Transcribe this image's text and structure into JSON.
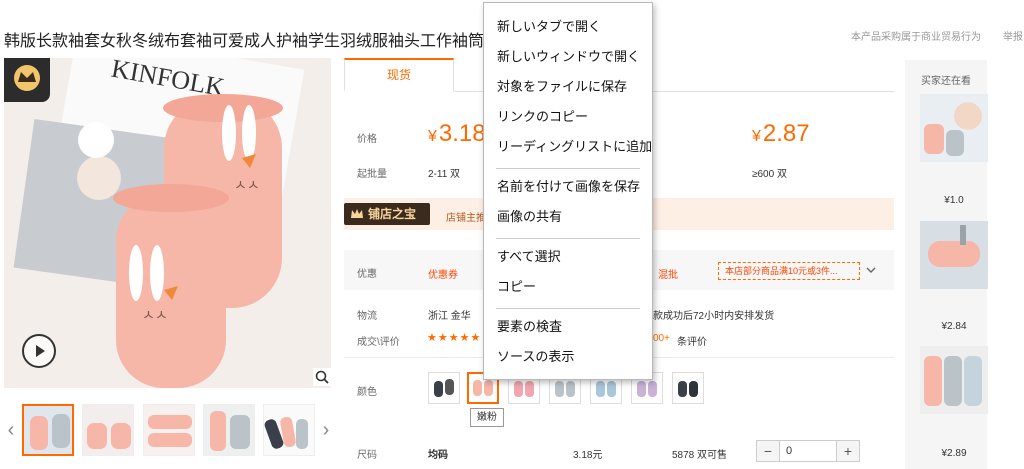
{
  "header": {
    "title": "韩版长款袖套女秋冬绒布套袖可爱成人护袖学生羽绒服袖头工作袖筒",
    "report_note": "本产品采购属于商业贸易行为",
    "report_link": "举报"
  },
  "tabs": {
    "active": "现货"
  },
  "price": {
    "label": "价格",
    "value_1": "3.18",
    "value_2": "2.87",
    "currency_symbol": "¥"
  },
  "moq": {
    "label": "起批量",
    "tier_1": "2-11 双",
    "tier_2": "≥600 双"
  },
  "shop": {
    "badge": "铺店之宝",
    "text": "店铺主推"
  },
  "promo": {
    "label": "优惠",
    "coupon": "优惠券",
    "mixed": "混批",
    "offer": "本店部分商品满10元或3件...",
    "expand_icon": "chevron-down-icon"
  },
  "logistics": {
    "label": "物流",
    "origin": "浙江 金华",
    "delivery": "款成功后72小时内安排发货"
  },
  "reviews": {
    "label": "成交\\评价",
    "stars": "★★★★★",
    "count": "00+",
    "count_suffix": "条评价"
  },
  "color": {
    "label": "颜色",
    "tooltip": "嫩粉"
  },
  "size": {
    "label": "尺码",
    "value": "均码",
    "price": "3.18元",
    "stock": "5878 双可售",
    "qty": "0",
    "minus": "−",
    "plus": "+"
  },
  "recommend": {
    "title": "买家还在看",
    "items": [
      {
        "price": "¥1.0"
      },
      {
        "price": "¥2.84"
      },
      {
        "price": "¥2.89"
      }
    ]
  },
  "thumb_nav": {
    "prev": "‹",
    "next": "›"
  },
  "context_menu": {
    "items_group1": [
      "新しいタブで開く",
      "新しいウィンドウで開く",
      "対象をファイルに保存",
      "リンクのコピー",
      "リーディングリストに追加"
    ],
    "items_group2": [
      "名前を付けて画像を保存",
      "画像の共有"
    ],
    "items_group3": [
      "すべて選択",
      "コピー"
    ],
    "items_group4": [
      "要素の検査",
      "ソースの表示"
    ]
  },
  "colors": {
    "accent": "#ff6a00",
    "sleeve_pink": "#f4b5a7",
    "sleeve_grey": "#b9c3c8",
    "sleeve_navy": "#3a3f4a"
  }
}
